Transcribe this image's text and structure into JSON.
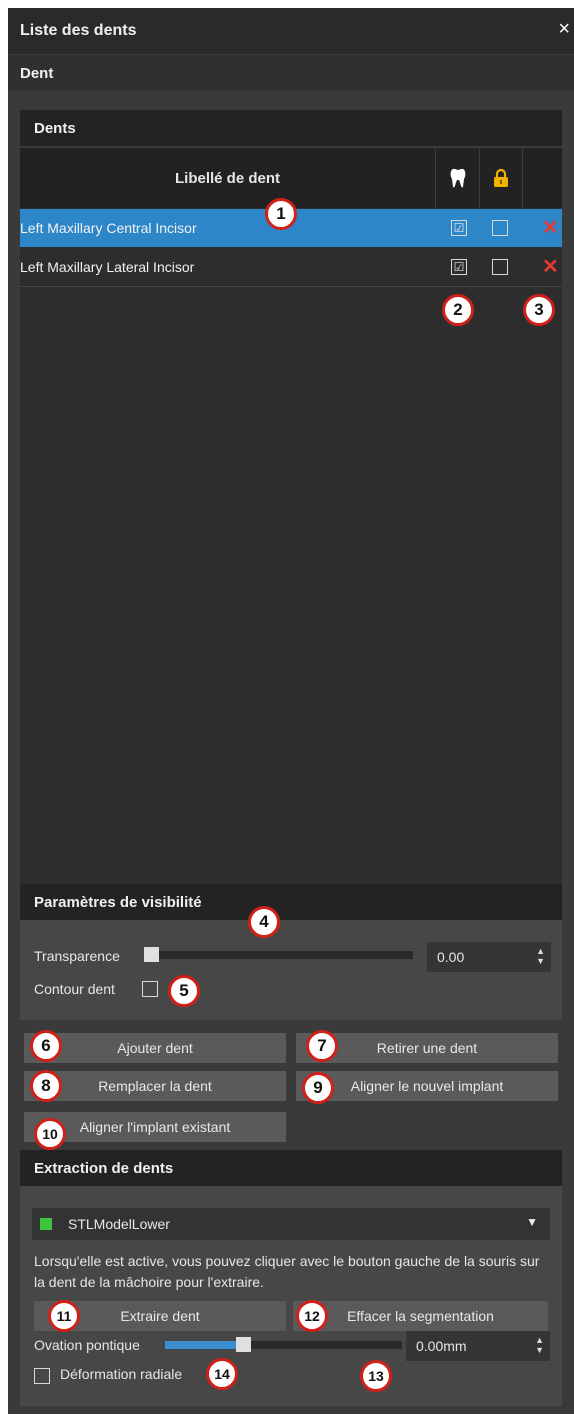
{
  "window": {
    "title": "Liste des dents",
    "close": "×"
  },
  "subheader": "Dent",
  "teeth": {
    "section_title": "Dents",
    "column_label": "Libellé de dent",
    "rows": [
      {
        "label": "Left Maxillary Central Incisor",
        "visible": "☑",
        "locked": "",
        "selected": true
      },
      {
        "label": "Left Maxillary Lateral Incisor",
        "visible": "☑",
        "locked": "",
        "selected": false
      }
    ],
    "delete_glyph": "✕"
  },
  "visibility": {
    "section_title": "Paramètres de visibilité",
    "transparency_label": "Transparence",
    "transparency_value": "0.00",
    "transparency_level": 0.0,
    "contour_label": "Contour dent"
  },
  "buttons": {
    "add": "Ajouter dent",
    "remove": "Retirer une dent",
    "replace": "Remplacer la dent",
    "align_new": "Aligner le nouvel implant",
    "align_existing": "Aligner l'implant existant"
  },
  "extraction": {
    "section_title": "Extraction de dents",
    "model": "STLModelLower",
    "model_color": "#3cc43c",
    "description": "Lorsqu'elle est active, vous pouvez cliquer avec le bouton gauche de la souris sur la dent de la mâchoire pour l'extraire.",
    "extract_button": "Extraire dent",
    "clear_button": "Effacer la segmentation",
    "ovation_label": "Ovation pontique",
    "ovation_value": "0.00mm",
    "ovation_level": 0.3,
    "radial_label": "Déformation radiale"
  },
  "callouts": [
    "1",
    "2",
    "3",
    "4",
    "5",
    "6",
    "7",
    "8",
    "9",
    "10",
    "11",
    "12",
    "13",
    "14"
  ],
  "colors": {
    "accent": "#2d86c8",
    "delete": "#e53935",
    "badge_ring": "#d0201a",
    "lock": "#f0b400"
  }
}
